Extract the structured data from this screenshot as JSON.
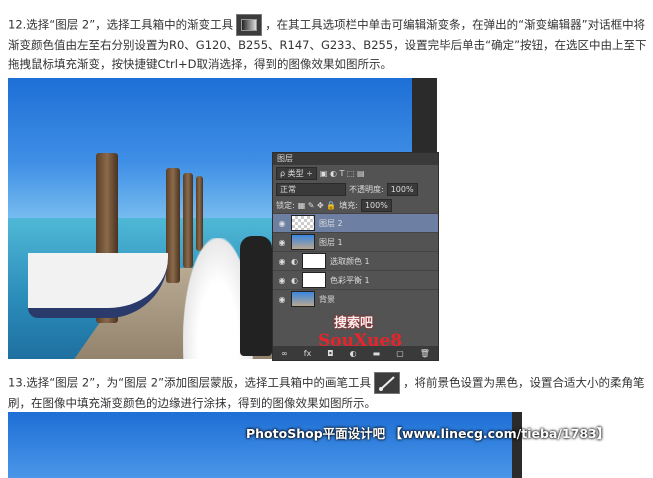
{
  "step12": {
    "text_a": "12.选择“图层 2”，选择工具箱中的渐变工具",
    "text_b": "，在其工具选项栏中单击可编辑渐变条，在弹出的“渐变编辑器”对话框中将渐变颜色值由左至右分别设置为R0、G120、B255、R147、G233、B255，设置完毕后单击“确定”按钮，在选区中由上至下拖拽鼠标填充渐变，按快捷键Ctrl+D取消选择，得到的图像效果如图所示。"
  },
  "step13": {
    "text_a": "13.选择“图层 2”，为“图层 2”添加图层蒙版，选择工具箱中的画笔工具",
    "text_b": "，将前景色设置为黑色，设置合适大小的柔角笔刷，在图像中填充渐变颜色的边缘进行涂抹，得到的图像效果如图所示。"
  },
  "layers_panel": {
    "title": "图层",
    "kind_label": "类型",
    "blend_mode": "正常",
    "opacity_label": "不透明度:",
    "opacity_value": "100%",
    "lock_label": "锁定:",
    "fill_label": "填充:",
    "fill_value": "100%",
    "layers": [
      {
        "name": "图层 2",
        "selected": true
      },
      {
        "name": "图层 1",
        "selected": false
      },
      {
        "name": "选取颜色 1",
        "selected": false
      },
      {
        "name": "色彩平衡 1",
        "selected": false
      },
      {
        "name": "背景",
        "selected": false
      }
    ]
  },
  "watermarks": {
    "sousuoba_cn": "搜索吧",
    "sousuoba_en": "SouXue8",
    "site": "PhotoShop平面设计吧 【www.linecg.com/tieba/1783】"
  },
  "colors": {
    "selected_layer": "#6d7fa2",
    "panel_bg": "#535353"
  }
}
